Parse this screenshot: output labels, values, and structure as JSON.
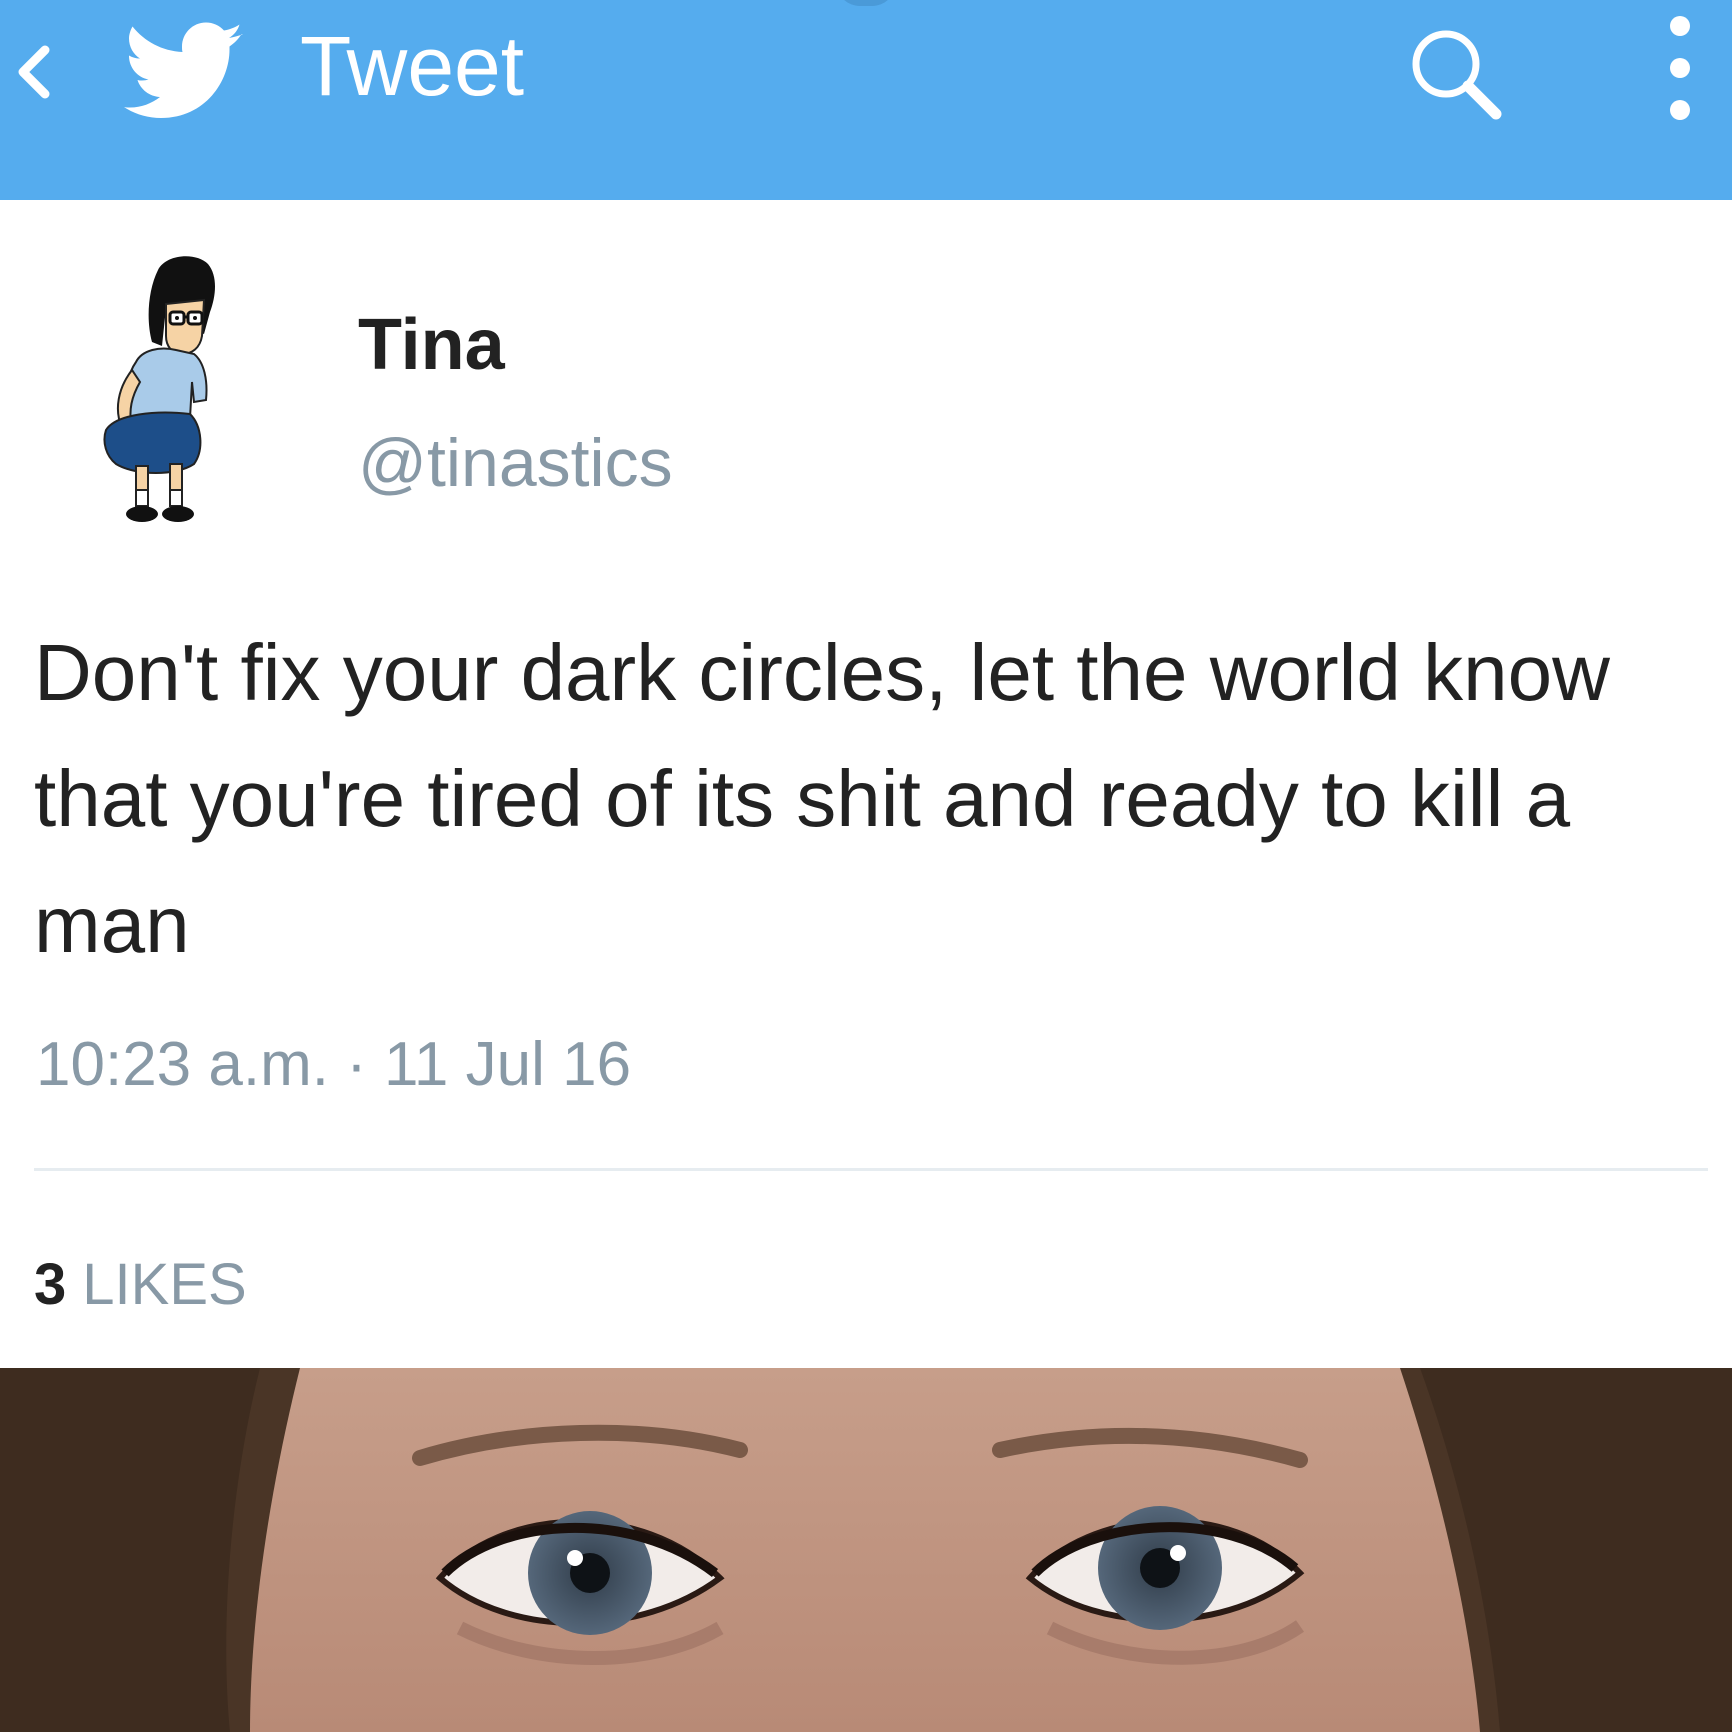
{
  "header": {
    "title": "Tweet",
    "back_icon": "chevron-left-icon",
    "logo_icon": "twitter-bird-icon",
    "search_icon": "search-icon",
    "more_icon": "more-vertical-icon",
    "color": "#55acee"
  },
  "tweet": {
    "display_name": "Tina",
    "handle": "@tinastics",
    "text": "Don't fix your dark circles, let the world know that you're tired of its shit and ready to kill a man",
    "timestamp": "10:23 a.m. · 11 Jul 16",
    "likes_count": "3",
    "likes_label": "LIKES"
  },
  "colors": {
    "text_primary": "#222222",
    "text_secondary": "#8899a6",
    "divider": "#e6ecf0"
  }
}
